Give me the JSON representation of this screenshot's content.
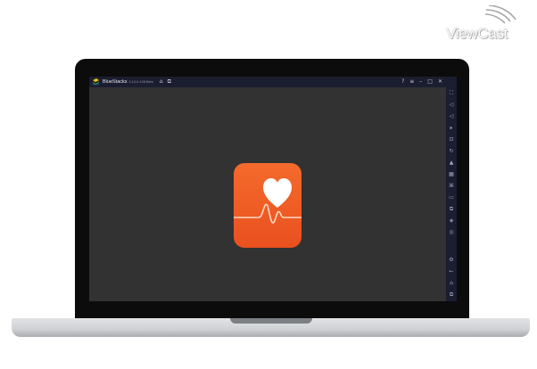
{
  "watermark": {
    "brand": "ViewCast"
  },
  "window": {
    "app_name": "BlueStacks",
    "version": "5.10.0.108 Beta"
  },
  "titlebar_icons": [
    "home-icon",
    "multi-instance-icon",
    "help-icon",
    "menu-icon",
    "minimize-icon",
    "maximize-icon",
    "close-icon"
  ],
  "sidebar_icons": [
    "fullscreen-icon",
    "volume-up-icon",
    "volume-down-icon",
    "media-icon",
    "screenshot-icon",
    "rotate-icon",
    "install-apk-icon",
    "macro-icon",
    "shake-icon",
    "folder-icon",
    "multi-instance-manager-icon",
    "eco-mode-icon",
    "location-icon",
    "settings-icon",
    "back-icon",
    "home-icon",
    "recent-apps-icon"
  ],
  "app": {
    "name": "health-app-icon",
    "accent": "#ef5d25"
  },
  "colors": {
    "titlebar": "#1b1d30",
    "screen": "#323232",
    "bezel": "#0c0c0c"
  }
}
